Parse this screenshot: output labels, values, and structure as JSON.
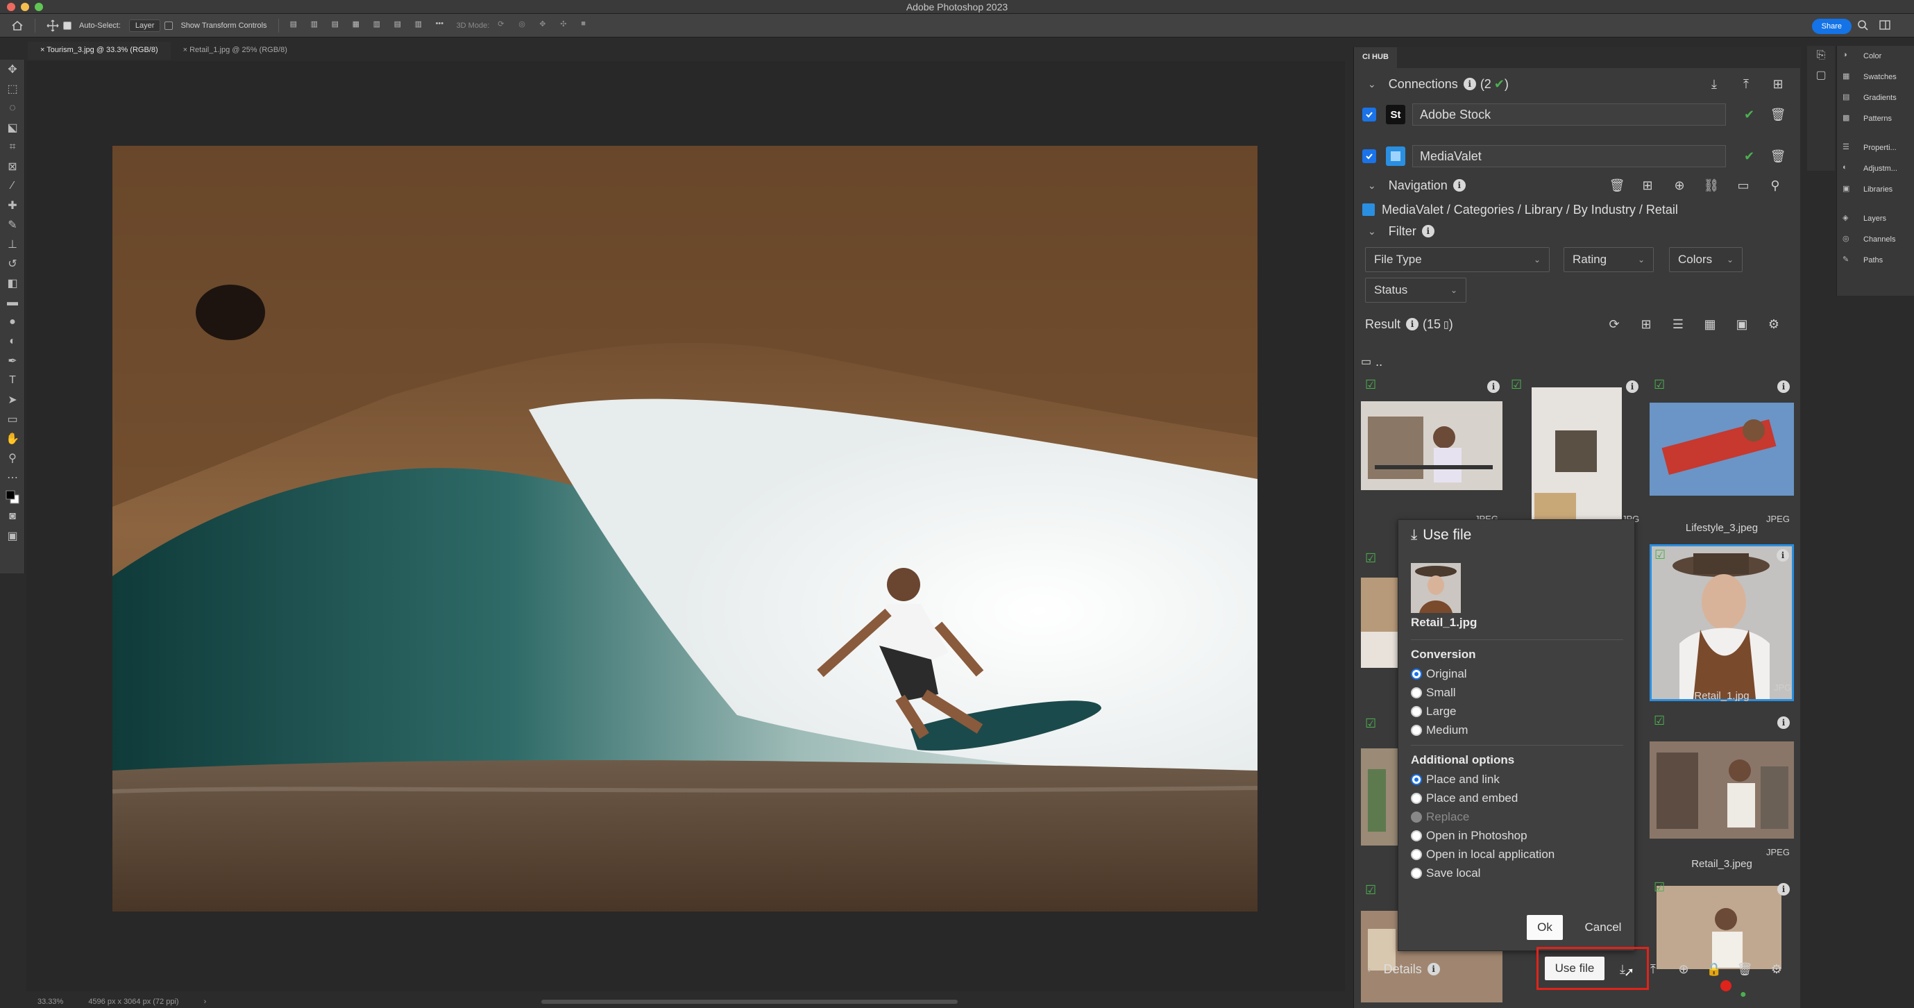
{
  "app": {
    "title": "Adobe Photoshop 2023"
  },
  "options_bar": {
    "auto_select_label": "Auto-Select:",
    "auto_select_value": "Layer",
    "show_transform_label": "Show Transform Controls",
    "mode_label": "3D Mode:",
    "share_label": "Share"
  },
  "tabs": [
    {
      "label": "Tourism_3.jpg @ 33.3% (RGB/8)"
    },
    {
      "label": "Retail_1.jpg @ 25% (RGB/8)"
    }
  ],
  "status": {
    "zoom": "33.33%",
    "doc_size": "4596 px x 3064 px (72 ppi)"
  },
  "mini_panels": [
    "Color",
    "Swatches",
    "Gradients",
    "Patterns",
    "Properti...",
    "Adjustm...",
    "Libraries",
    "Layers",
    "Channels",
    "Paths"
  ],
  "hub": {
    "tab_label": "CI HUB",
    "connections_label": "Connections",
    "connections_count": "(2",
    "connections": [
      {
        "badge": "St",
        "name": "Adobe Stock"
      },
      {
        "badge": "",
        "name": "MediaValet"
      }
    ],
    "navigation_label": "Navigation",
    "breadcrumb": "MediaValet / Categories / Library / By Industry / Retail",
    "filter_label": "Filter",
    "filters": {
      "file_type": "File Type",
      "rating": "Rating",
      "colors": "Colors",
      "status": "Status"
    },
    "result_label": "Result",
    "result_count": "(15",
    "folder_up": "..",
    "thumbs": [
      {
        "badge": "JPEG",
        "label": ""
      },
      {
        "badge": "JPG",
        "label": ""
      },
      {
        "badge": "JPEG",
        "label": "Lifestyle_3.jpeg"
      },
      {
        "badge": "JPG",
        "label": "Retail_1.jpg"
      },
      {
        "badge": "JPEG",
        "label": "Retail_3.jpeg"
      }
    ],
    "details_label": "Details"
  },
  "use_file": {
    "title": "Use file",
    "file_name": "Retail_1.jpg",
    "conversion_title": "Conversion",
    "conversion_options": [
      "Original",
      "Small",
      "Large",
      "Medium"
    ],
    "conversion_selected": "Original",
    "additional_title": "Additional options",
    "additional_options": [
      "Place and link",
      "Place and embed",
      "Replace",
      "Open in Photoshop",
      "Open in local application",
      "Save local"
    ],
    "additional_selected": "Place and link",
    "ok_label": "Ok",
    "cancel_label": "Cancel",
    "tooltip": "Use file"
  },
  "colors": {
    "accent": "#1a73e8",
    "highlight": "#e0231b",
    "success": "#4caf50"
  }
}
